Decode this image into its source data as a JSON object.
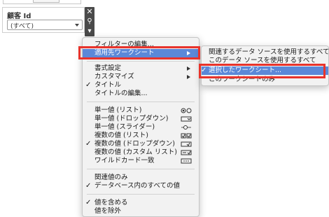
{
  "filter_card": {
    "title": "顧客 Id",
    "selected_value": "(すべて)"
  },
  "card_tools": {
    "close_glyph": "✕",
    "pin_glyph": "⚲",
    "menu_glyph": "▾"
  },
  "main_menu": {
    "items": [
      {
        "label": "フィルターの編集..."
      },
      {
        "label": "適用先ワークシート"
      },
      {
        "label": "書式設定"
      },
      {
        "label": "カスタマイズ"
      },
      {
        "label": "タイトル"
      },
      {
        "label": "タイトルの編集..."
      },
      {
        "label": "単一値 (リスト)"
      },
      {
        "label": "単一値 (ドロップダウン)"
      },
      {
        "label": "単一値 (スライダー)"
      },
      {
        "label": "複数の値 (リスト)"
      },
      {
        "label": "複数の値 (ドロップダウン)"
      },
      {
        "label": "複数の値 (カスタム リスト)"
      },
      {
        "label": "ワイルドカード一致"
      },
      {
        "label": "関連値のみ"
      },
      {
        "label": "データベース内のすべての値"
      },
      {
        "label": "値を含める"
      },
      {
        "label": "値を除外"
      }
    ],
    "check_glyph": "✓"
  },
  "sub_menu": {
    "items": [
      {
        "label": "関連するデータ ソースを使用するすべて"
      },
      {
        "label": "このデータ ソースを使用するすべて"
      },
      {
        "label": "選択したワークシート..."
      },
      {
        "label": "このワークシートのみ"
      }
    ]
  },
  "colors": {
    "highlight": "#5b88d8",
    "annotation_red": "#e8332b",
    "menu_bg": "#f2f2f2"
  }
}
